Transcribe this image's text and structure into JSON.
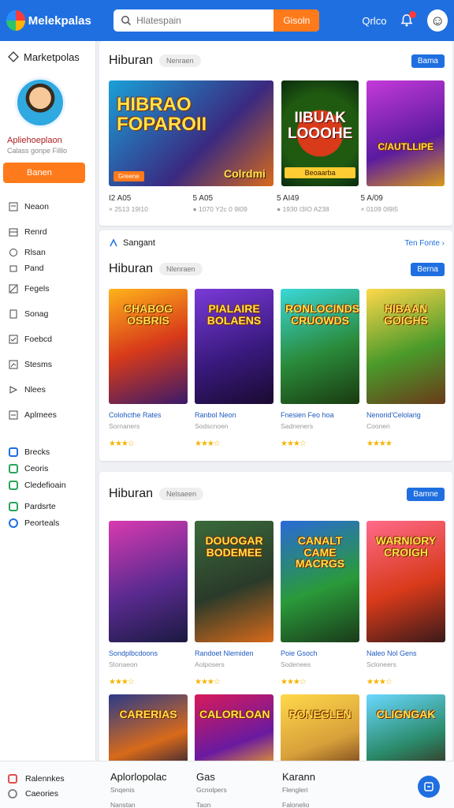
{
  "header": {
    "brand": "Melekpalas",
    "search_placeholder": "Hlatespain",
    "search_button": "Gisoln",
    "link": "Qrlco",
    "avatar_icon": "user-avatar-icon"
  },
  "sidebar": {
    "title": "Marketpolas",
    "profile_name": "Apliehoeplaon",
    "profile_sub": "Calass gonpe Filllo",
    "cta": "Banen",
    "items": [
      {
        "label": "Neaon",
        "icon": "list-icon"
      },
      {
        "label": "Renrd",
        "icon": "inbox-icon"
      },
      {
        "label": "Rlsan",
        "icon": "chat-icon"
      },
      {
        "label": "Pand",
        "icon": "box-icon"
      },
      {
        "label": "Fegels",
        "icon": "tag-icon"
      },
      {
        "label": "Sonag",
        "icon": "doc-icon"
      },
      {
        "label": "Foebcd",
        "icon": "check-icon"
      },
      {
        "label": "Stesms",
        "icon": "chart-icon"
      },
      {
        "label": "Nlees",
        "icon": "flag-icon"
      },
      {
        "label": "Aplmees",
        "icon": "menu-icon"
      }
    ],
    "items2": [
      {
        "label": "Brecks",
        "color": "#1f6fe0"
      },
      {
        "label": "Ceoris",
        "color": "#29a55b"
      },
      {
        "label": "Cledefioain",
        "color": "#29a55b"
      },
      {
        "label": "Pardsrte",
        "color": "#29a55b"
      },
      {
        "label": "Peorteals",
        "color": "#1f6fe0"
      }
    ]
  },
  "section1": {
    "title": "Hiburan",
    "chip": "Nenraen",
    "button": "Bama",
    "hero_label": "HIBRAO FOPAROII",
    "hero_tag": "Greene",
    "hero_sub": "Colrdmi",
    "tile1_label": "IIBUAK LOOOHE",
    "tile1_banner": "Beoaarba",
    "tile2_label": "C/AUTLLIPE",
    "stats": [
      {
        "a": "I2 A05",
        "b": "× 2513 19I10"
      },
      {
        "a": "5 A05",
        "b": "● 1070 Y2c 0 9I09"
      },
      {
        "a": "5 AI49",
        "b": "● 1930 I3IO A238"
      },
      {
        "a": "5 A/09",
        "b": "× 0109 0I9I5"
      }
    ]
  },
  "subrow": {
    "label": "Sangant",
    "link": "Ten Fonte"
  },
  "section2": {
    "title": "Hiburan",
    "chip": "Nlenraen",
    "button": "Berna",
    "games": [
      {
        "label": "CHABOG OSBRIS",
        "title": "Colohcthe Rates",
        "sub": "Sornaners",
        "stars": "★★★☆"
      },
      {
        "label": "PIALAIRE BOLAENS",
        "title": "Ranbol Neon",
        "sub": "Sodscnoen",
        "stars": "★★★☆"
      },
      {
        "label": "RONLOCINDS CRUOWDS",
        "title": "Fnesien Feo hoa",
        "sub": "Sadneners",
        "stars": "★★★☆"
      },
      {
        "label": "HIBAAN GOIGHS",
        "title": "Nenorid'Celolarig",
        "sub": "Coonen",
        "stars": "★★★★"
      }
    ]
  },
  "section3": {
    "title": "Hiburan",
    "chip": "Nelsaeen",
    "button": "Bamne",
    "games": [
      {
        "label": "",
        "title": "Sondplbcdoons",
        "sub": "Stonaeon",
        "stars": "★★★☆"
      },
      {
        "label": "DOUOGAR BODEMEE",
        "title": "Randoet Nlemiden",
        "sub": "Aolposers",
        "stars": "★★★☆"
      },
      {
        "label": "CANALT CAME MACRGS",
        "title": "Poie Gsoch",
        "sub": "Sodenees",
        "stars": "★★★☆"
      },
      {
        "label": "WARNIORY CROIGH",
        "title": "Naleo Nol Gens",
        "sub": "Scloneers",
        "stars": "★★★☆"
      }
    ],
    "row2": [
      {
        "label": "CARERIAS"
      },
      {
        "label": "CALORLOAN"
      },
      {
        "label": "RONEGLEN"
      },
      {
        "label": "CLIGNGAK"
      }
    ]
  },
  "bottom": {
    "left": [
      {
        "label": "Ralennkes",
        "color": "#e05050"
      },
      {
        "label": "Caeories",
        "color": "#888888"
      }
    ],
    "cols": [
      {
        "title": "Aplorlopolac",
        "sub": "Snqenis",
        "sub2": "Nanstan"
      },
      {
        "title": "Gas",
        "sub": "Gcnolpers",
        "sub2": "Taon"
      },
      {
        "title": "Karann",
        "sub": "Flengleri",
        "sub2": "Falonelio"
      }
    ],
    "fab_icon": "help-icon"
  }
}
